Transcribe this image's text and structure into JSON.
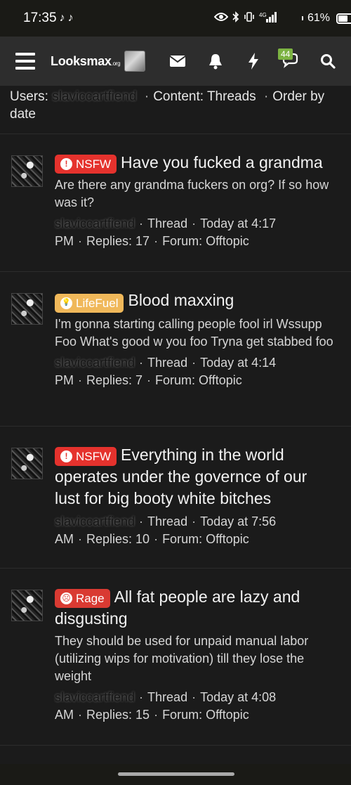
{
  "status_bar": {
    "time": "17:35",
    "battery": "61%",
    "battery_level": 0.61,
    "signal": "4G"
  },
  "header": {
    "logo_text": "Looksmax",
    "logo_suffix": ".org",
    "alerts_count": "44"
  },
  "filter": {
    "users_label": "Users:",
    "user": "slaviccartfiend",
    "content": "Content: Threads",
    "order": "Order by date"
  },
  "results": [
    {
      "prefix": "NSFW",
      "prefix_icon": "!",
      "title": "Have you fucked a grandma",
      "snippet": "Are there any grandma fuckers on org? If so how was it?",
      "author": "slaviccartfiend",
      "type": "Thread",
      "time": "Today at 4:17 PM",
      "replies": "Replies: 17",
      "forum": "Forum: Offtopic"
    },
    {
      "prefix": "LifeFuel",
      "prefix_icon": "💡",
      "title": "Blood maxxing",
      "snippet": "I'm gonna starting calling people fool irl Wssupp Foo What's good w you foo Tryna get stabbed foo",
      "author": "slaviccartfiend",
      "type": "Thread",
      "time": "Today at 4:14 PM",
      "replies": "Replies: 7",
      "forum": "Forum: Offtopic"
    },
    {
      "prefix": "NSFW",
      "prefix_icon": "!",
      "title": "Everything in the world operates under the governce of our lust for big booty white bitches",
      "snippet": "",
      "author": "slaviccartfiend",
      "type": "Thread",
      "time": "Today at 7:56 AM",
      "replies": "Replies: 10",
      "forum": "Forum: Offtopic"
    },
    {
      "prefix": "Rage",
      "prefix_icon": "☹",
      "title": "All fat people are lazy and disgusting",
      "snippet": "They should be used for unpaid manual labor (utilizing wips for motivation) till they lose the weight",
      "author": "slaviccartfiend",
      "type": "Thread",
      "time": "Today at 4:08 AM",
      "replies": "Replies: 15",
      "forum": "Forum: Offtopic"
    }
  ],
  "colors": {
    "nsfw": "#e5322d",
    "lifefuel": "#f0b85a",
    "rage": "#d93a32",
    "alerts_badge": "#7cb342"
  }
}
